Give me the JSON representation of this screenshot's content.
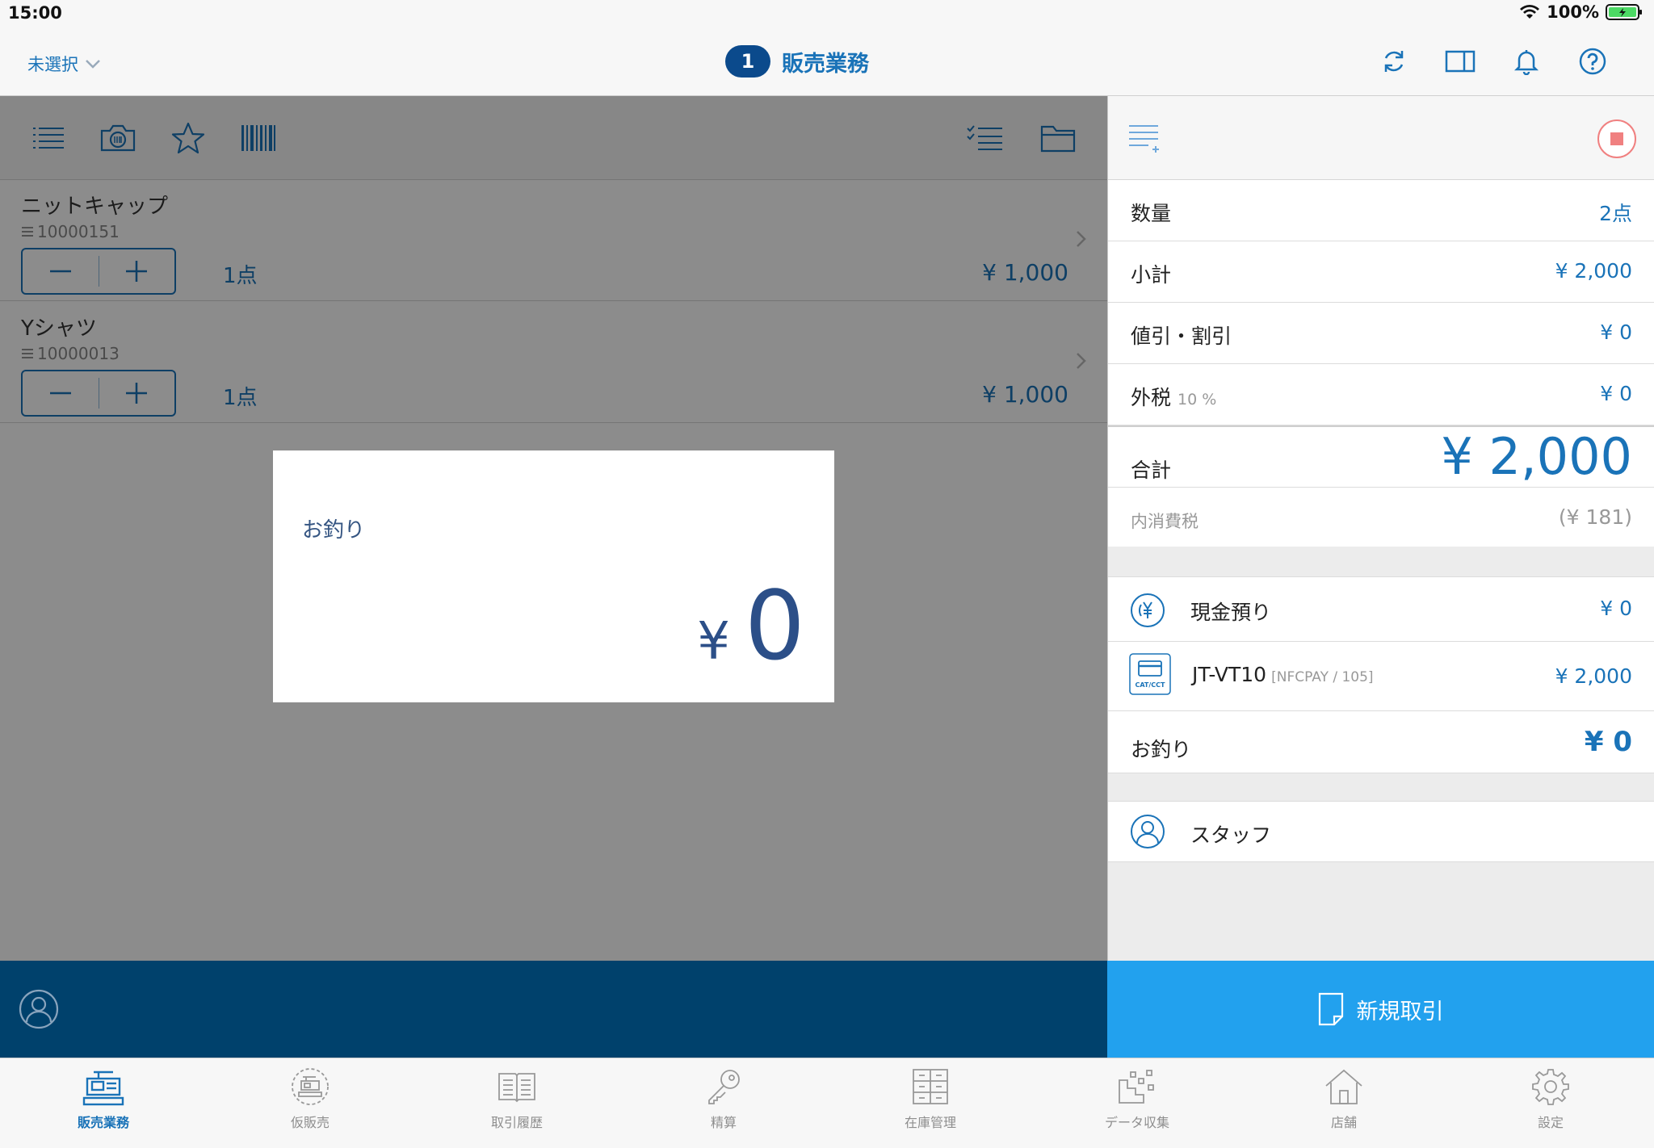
{
  "status_bar": {
    "time": "15:00",
    "battery": "100%"
  },
  "nav": {
    "store_select": "未選択",
    "badge_count": "1",
    "title": "販売業務"
  },
  "items": [
    {
      "name": "ニットキャップ",
      "code": "10000151",
      "qty": "1点",
      "price": "¥ 1,000"
    },
    {
      "name": "Yシャツ",
      "code": "10000013",
      "qty": "1点",
      "price": "¥ 1,000"
    }
  ],
  "change_popup": {
    "label": "お釣り",
    "yen": "¥",
    "value": "0"
  },
  "summary": {
    "quantity": {
      "label": "数量",
      "value": "2点"
    },
    "subtotal": {
      "label": "小計",
      "value": "¥ 2,000"
    },
    "discount": {
      "label": "値引・割引",
      "value": "¥ 0"
    },
    "outer_tax": {
      "label": "外税",
      "rate": "10 %",
      "value": "¥ 0"
    },
    "total": {
      "label": "合計",
      "value": "¥ 2,000"
    },
    "inner_tax": {
      "label": "内消費税",
      "value": "(¥ 181)"
    }
  },
  "payments": {
    "cash": {
      "label": "現金預り",
      "value": "¥ 0"
    },
    "card": {
      "label": "JT-VT10",
      "detail": "[NFCPAY / 105]",
      "value": "¥ 2,000",
      "icon_text": "CAT/CCT"
    },
    "change": {
      "label": "お釣り",
      "value": "¥ 0"
    }
  },
  "staff": {
    "label": "スタッフ"
  },
  "new_transaction": {
    "label": "新規取引"
  },
  "tabs": [
    {
      "label": "販売業務",
      "icon": "register-icon",
      "active": true
    },
    {
      "label": "仮販売",
      "icon": "temp-sale-icon",
      "active": false
    },
    {
      "label": "取引履歴",
      "icon": "history-icon",
      "active": false
    },
    {
      "label": "精算",
      "icon": "key-icon",
      "active": false
    },
    {
      "label": "在庫管理",
      "icon": "inventory-icon",
      "active": false
    },
    {
      "label": "データ収集",
      "icon": "data-collect-icon",
      "active": false
    },
    {
      "label": "店舗",
      "icon": "store-icon",
      "active": false
    },
    {
      "label": "設定",
      "icon": "settings-icon",
      "active": false
    }
  ],
  "colors": {
    "accent": "#1a73b8",
    "nav_badge": "#0b4a8c",
    "bottom_bar": "#00416c",
    "new_transaction": "#22a1ee",
    "stop_button": "#f08080"
  }
}
